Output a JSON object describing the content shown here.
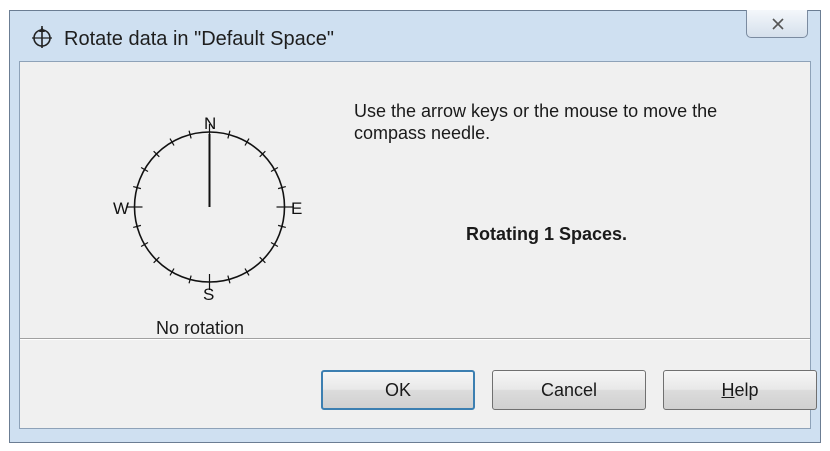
{
  "window": {
    "title": "Rotate data in \"Default Space\"",
    "icon": "compass-icon",
    "close_icon": "close-icon"
  },
  "compass": {
    "north_label": "N",
    "south_label": "S",
    "east_label": "E",
    "west_label": "W",
    "rotation_label": "No rotation"
  },
  "instructions": "Use the arrow keys or the mouse to move the compass needle.",
  "status": "Rotating 1 Spaces.",
  "buttons": {
    "ok": "OK",
    "cancel": "Cancel",
    "help_mnemonic": "H",
    "help_rest": "elp"
  },
  "colors": {
    "window_frame": "#cfe0f1",
    "client_bg": "#f0f0f0",
    "default_button_border": "#3c7fb1"
  }
}
